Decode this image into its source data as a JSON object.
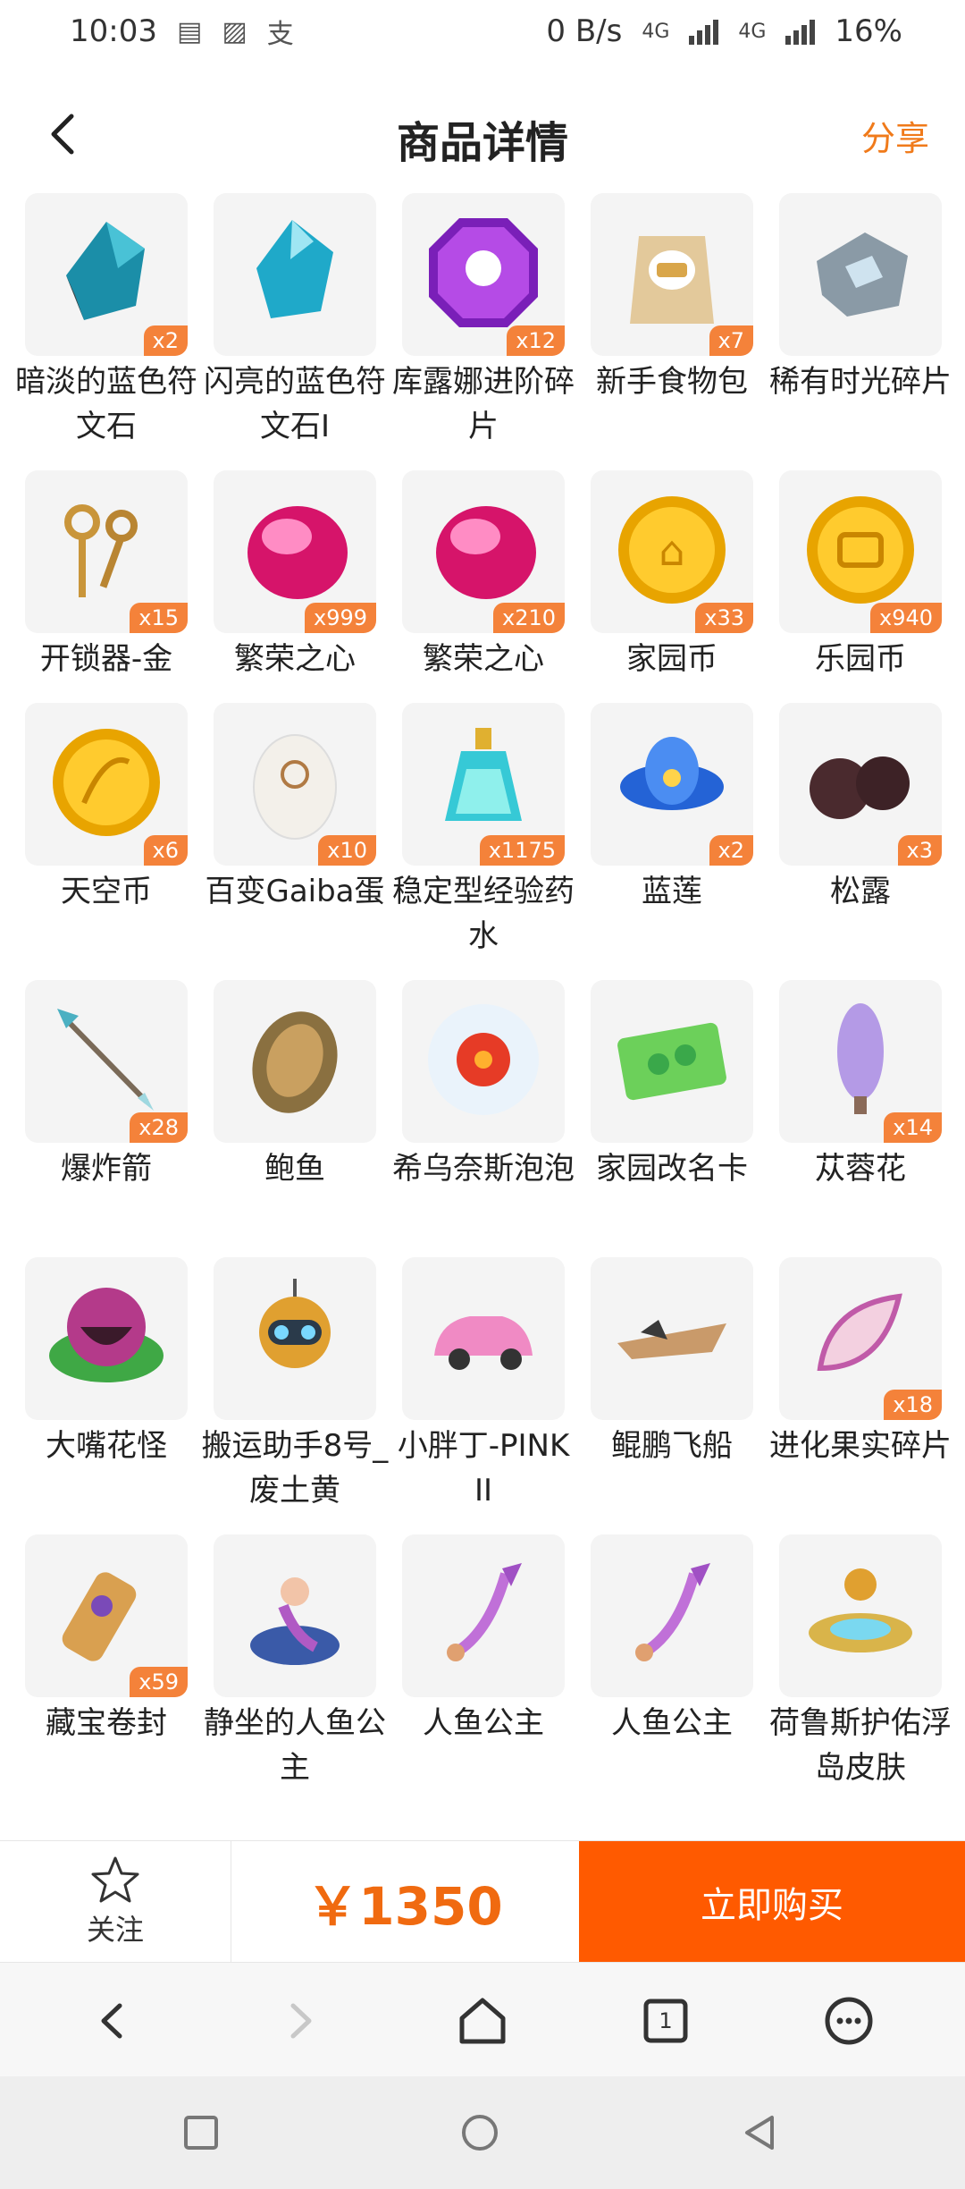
{
  "status_bar": {
    "time": "10:03",
    "speed": "0 B/s",
    "net1": "4G",
    "net2": "4G",
    "battery": "16%"
  },
  "header": {
    "title": "商品详情",
    "share": "分享"
  },
  "items": [
    {
      "name": "暗淡的蓝色符文石",
      "qty": "x2",
      "icon": "dark-blue-rune-stone"
    },
    {
      "name": "闪亮的蓝色符文石I",
      "qty": "",
      "icon": "shiny-blue-rune-stone"
    },
    {
      "name": "库露娜进阶碎片",
      "qty": "x12",
      "icon": "kuluna-fragment"
    },
    {
      "name": "新手食物包",
      "qty": "x7",
      "icon": "food-pack"
    },
    {
      "name": "稀有时光碎片",
      "qty": "",
      "icon": "time-fragment"
    },
    {
      "name": "开锁器-金",
      "qty": "x15",
      "icon": "gold-keys"
    },
    {
      "name": "繁荣之心",
      "qty": "x999",
      "icon": "pink-heart-gem"
    },
    {
      "name": "繁荣之心",
      "qty": "x210",
      "icon": "pink-heart-gem"
    },
    {
      "name": "家园币",
      "qty": "x33",
      "icon": "home-coin"
    },
    {
      "name": "乐园币",
      "qty": "x940",
      "icon": "park-coin"
    },
    {
      "name": "天空币",
      "qty": "x6",
      "icon": "sky-coin"
    },
    {
      "name": "百变Gaiba蛋",
      "qty": "x10",
      "icon": "gaiba-egg"
    },
    {
      "name": "稳定型经验药水",
      "qty": "x1175",
      "icon": "exp-potion"
    },
    {
      "name": "蓝莲",
      "qty": "x2",
      "icon": "blue-lotus"
    },
    {
      "name": "松露",
      "qty": "x3",
      "icon": "truffle"
    },
    {
      "name": "爆炸箭",
      "qty": "x28",
      "icon": "explosive-arrow"
    },
    {
      "name": "鲍鱼",
      "qty": "",
      "icon": "abalone"
    },
    {
      "name": "希乌奈斯泡泡",
      "qty": "",
      "icon": "flower-bubble"
    },
    {
      "name": "家园改名卡",
      "qty": "",
      "icon": "rename-card"
    },
    {
      "name": "苁蓉花",
      "qty": "x14",
      "icon": "cistanche-flower"
    },
    {
      "name": "大嘴花怪",
      "qty": "",
      "icon": "piranha-plant"
    },
    {
      "name": "搬运助手8号_废土黄",
      "qty": "",
      "icon": "robot-helper"
    },
    {
      "name": "小胖丁-PINK II",
      "qty": "",
      "icon": "pink-car"
    },
    {
      "name": "鲲鹏飞船",
      "qty": "",
      "icon": "airship"
    },
    {
      "name": "进化果实碎片",
      "qty": "x18",
      "icon": "fruit-fragment"
    },
    {
      "name": "藏宝卷封",
      "qty": "x59",
      "icon": "treasure-scroll"
    },
    {
      "name": "静坐的人鱼公主",
      "qty": "",
      "icon": "mermaid-sitting"
    },
    {
      "name": "人鱼公主",
      "qty": "",
      "icon": "mermaid-tail"
    },
    {
      "name": "人鱼公主",
      "qty": "",
      "icon": "mermaid-tail"
    },
    {
      "name": "荷鲁斯护佑浮岛皮肤",
      "qty": "",
      "icon": "floating-island"
    }
  ],
  "action_bar": {
    "follow": "关注",
    "price": "￥1350",
    "buy": "立即购买"
  },
  "browser_nav": {
    "tab_count": "1"
  },
  "colors": {
    "accent": "#ff5a00",
    "price": "#f06a10",
    "badge": "#f4823a",
    "share": "#f07a1a"
  }
}
